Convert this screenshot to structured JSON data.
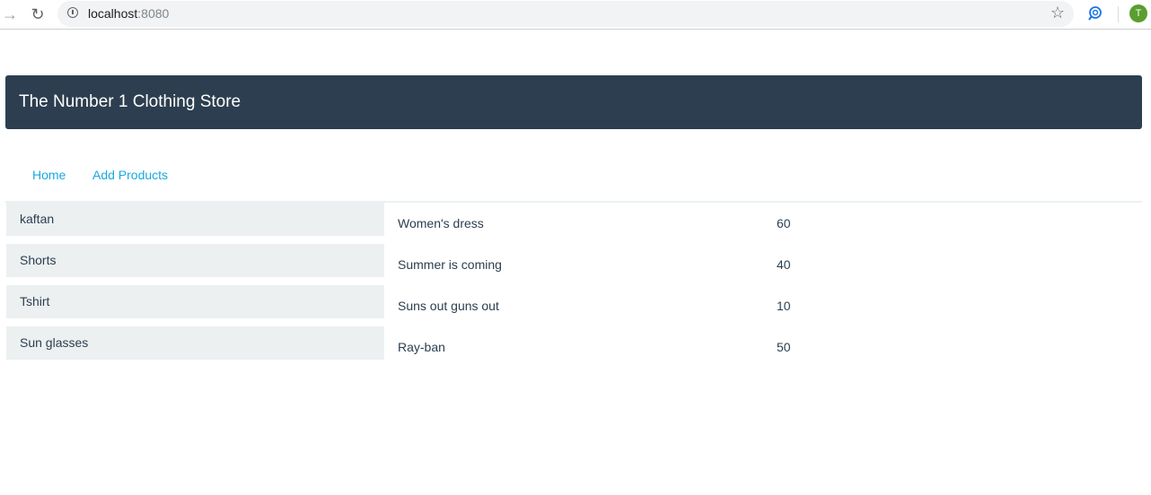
{
  "browser": {
    "url_host": "localhost",
    "url_port": ":8080",
    "avatar_letter": "T"
  },
  "header": {
    "title": "The Number 1 Clothing Store"
  },
  "nav": {
    "home": "Home",
    "add_products": "Add Products"
  },
  "categories": [
    {
      "label": "kaftan"
    },
    {
      "label": "Shorts"
    },
    {
      "label": "Tshirt"
    },
    {
      "label": "Sun glasses"
    }
  ],
  "products": [
    {
      "name": "Women's dress",
      "value": "60"
    },
    {
      "name": "Summer is coming",
      "value": "40"
    },
    {
      "name": "Suns out guns out",
      "value": "10"
    },
    {
      "name": "Ray-ban",
      "value": "50"
    }
  ],
  "colors": {
    "header_bg": "#2c3e50",
    "link": "#18a9e0",
    "list_bg": "#ecf0f1"
  }
}
